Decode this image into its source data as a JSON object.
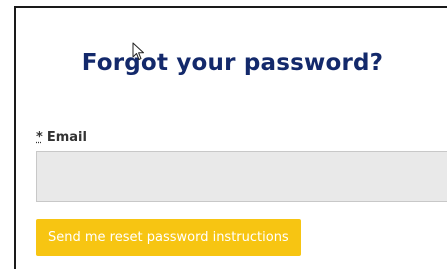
{
  "page": {
    "title": "Forgot your password?"
  },
  "form": {
    "required_marker": "*",
    "email_label": "Email",
    "email_value": "",
    "email_placeholder": "",
    "submit_label": "Send me reset password instructions"
  },
  "colors": {
    "title": "#13296b",
    "button_background": "#f7c512",
    "button_text": "#ffffff",
    "input_background": "#e9e9e9"
  },
  "icons": {
    "cursor": "mouse-pointer-icon"
  }
}
